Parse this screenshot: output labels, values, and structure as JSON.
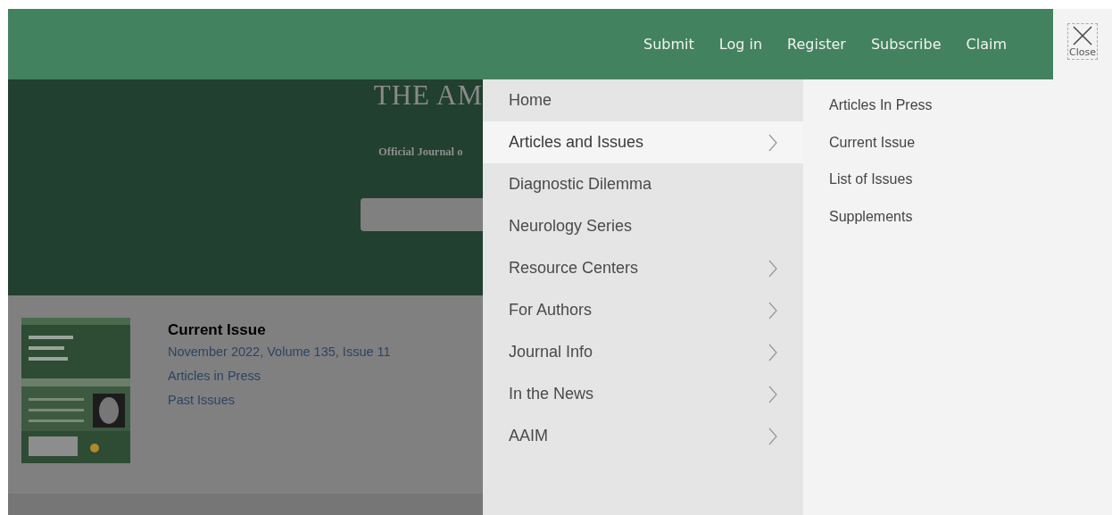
{
  "header": {
    "links": [
      "Submit",
      "Log in",
      "Register",
      "Subscribe",
      "Claim"
    ],
    "close_button": {
      "label": "Close"
    }
  },
  "hero": {
    "title": "THE AM",
    "subtitle": "Official Journal o",
    "search": {
      "kind": "field"
    }
  },
  "current_issue": {
    "cover": {
      "kind": "picture"
    },
    "heading": "Current Issue",
    "links": [
      "November 2022, Volume 135, Issue 11",
      "Articles in Press",
      "Past Issues"
    ]
  },
  "menu": {
    "items": [
      {
        "label": "Home",
        "has_submenu": false,
        "selected": false
      },
      {
        "label": "Articles and Issues",
        "has_submenu": true,
        "selected": true
      },
      {
        "label": "Diagnostic Dilemma",
        "has_submenu": false,
        "selected": false
      },
      {
        "label": "Neurology Series",
        "has_submenu": false,
        "selected": false
      },
      {
        "label": "Resource Centers",
        "has_submenu": true,
        "selected": false
      },
      {
        "label": "For Authors",
        "has_submenu": true,
        "selected": false
      },
      {
        "label": "Journal Info",
        "has_submenu": true,
        "selected": false
      },
      {
        "label": "In the News",
        "has_submenu": true,
        "selected": false
      },
      {
        "label": "AAIM",
        "has_submenu": true,
        "selected": false
      }
    ]
  },
  "submenu": {
    "items": [
      "Articles In Press",
      "Current Issue",
      "List of Issues",
      "Supplements"
    ]
  }
}
